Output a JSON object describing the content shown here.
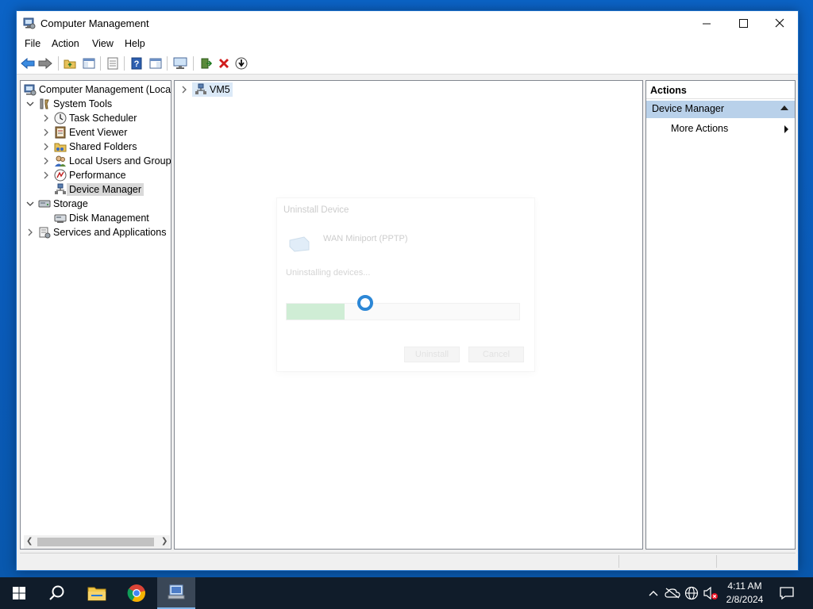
{
  "window": {
    "title": "Computer Management"
  },
  "menu": [
    "File",
    "Action",
    "View",
    "Help"
  ],
  "toolbar": {
    "icons": [
      "back-icon",
      "forward-icon",
      "up-folder-icon",
      "show-hide-tree-icon",
      "properties-icon",
      "help-icon",
      "show-hide-action-icon",
      "monitor-icon",
      "update-driver-icon",
      "uninstall-icon",
      "download-icon"
    ]
  },
  "tree": {
    "root": "Computer Management (Local",
    "items": [
      {
        "label": "System Tools"
      },
      {
        "label": "Task Scheduler"
      },
      {
        "label": "Event Viewer"
      },
      {
        "label": "Shared Folders"
      },
      {
        "label": "Local Users and Groups"
      },
      {
        "label": "Performance"
      },
      {
        "label": "Device Manager"
      },
      {
        "label": "Storage"
      },
      {
        "label": "Disk Management"
      },
      {
        "label": "Services and Applications"
      }
    ]
  },
  "center": {
    "node": "VM5"
  },
  "actions": {
    "header": "Actions",
    "section": "Device Manager",
    "item": "More Actions"
  },
  "dialog": {
    "title": "Uninstall Device",
    "device": "WAN Miniport (PPTP)",
    "status": "Uninstalling devices...",
    "progress": 0.25,
    "buttons": [
      "Uninstall",
      "Cancel"
    ]
  },
  "taskbar": {
    "time": "4:11 AM",
    "date": "2/8/2024"
  },
  "colors": {
    "accent": "#2c87d6",
    "selection": "#b9d1ea",
    "progress": "#8fd69c",
    "desktop": "#0b63c6"
  }
}
